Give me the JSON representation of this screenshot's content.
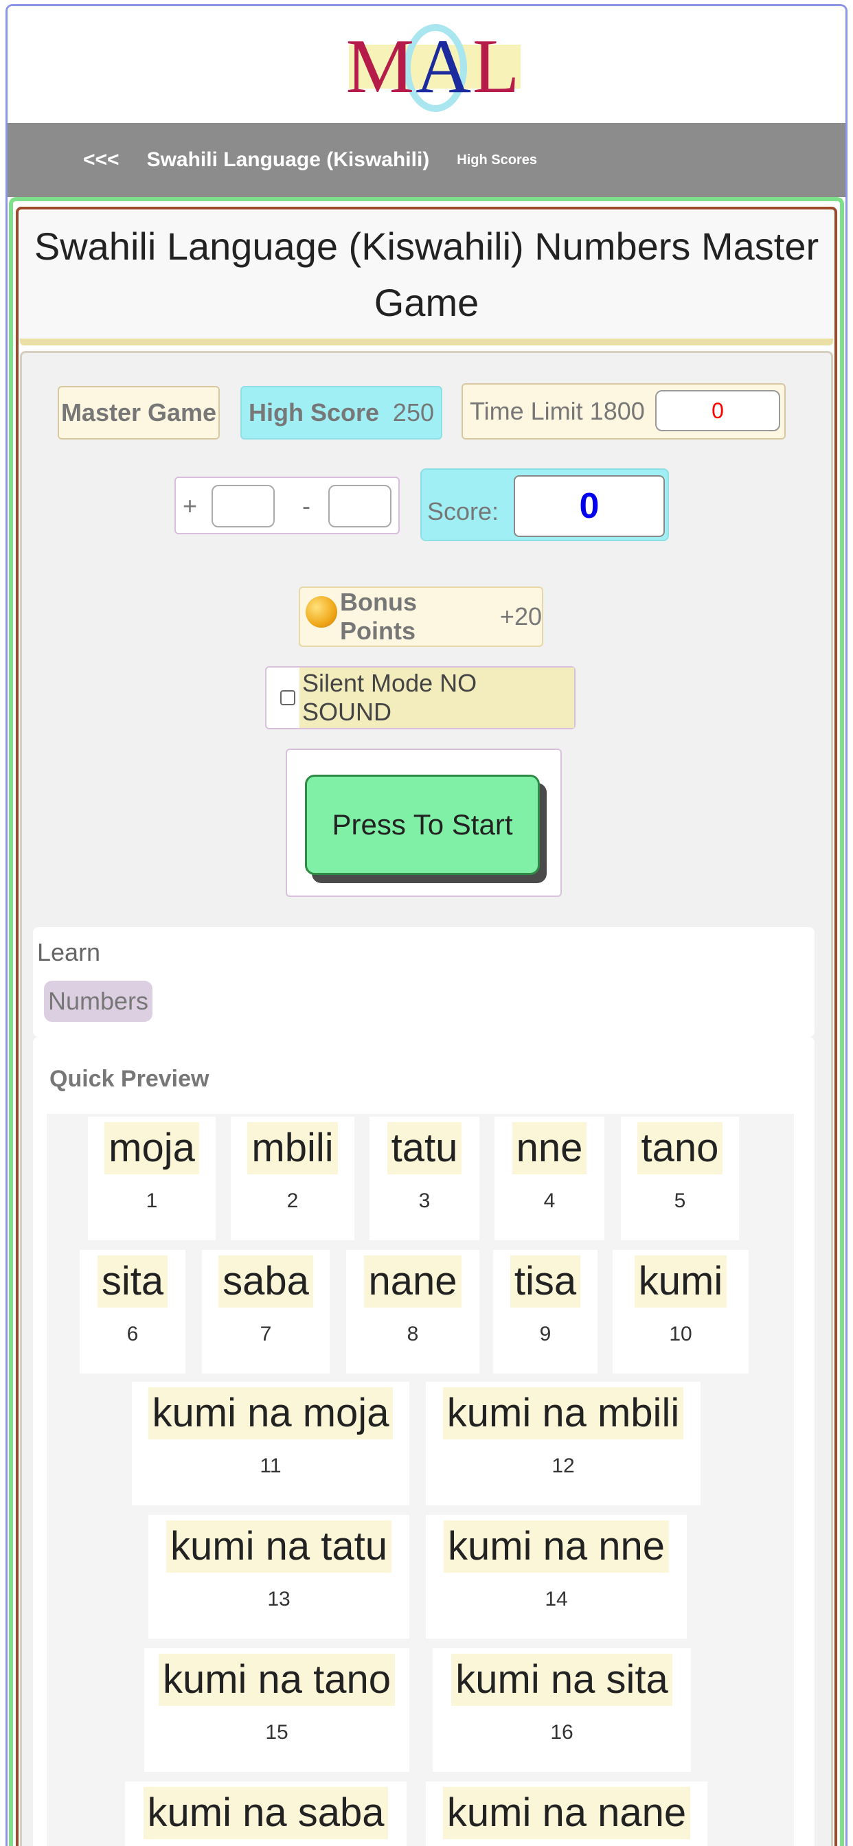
{
  "logo": {
    "letters": [
      "M",
      "A",
      "L"
    ]
  },
  "nav": {
    "back_label": "<<<",
    "crumb_label": "Swahili Language (Kiswahili)",
    "high_scores_label": "High Scores"
  },
  "page": {
    "title": "Swahili Language (Kiswahili) Numbers Master Game"
  },
  "game": {
    "mode_label": "Master Game",
    "high_score_label": "High Score",
    "high_score_value": "250",
    "time_limit_label": "Time Limit 1800",
    "time_value": "0",
    "plus_symbol": "+",
    "minus_symbol": "-",
    "score_label": "Score:",
    "score_value": "0",
    "bonus_label": "Bonus Points",
    "bonus_value": "+20",
    "silent_label": "Silent Mode NO SOUND",
    "start_label": "Press To Start"
  },
  "learn": {
    "label": "Learn",
    "tag": "Numbers"
  },
  "preview": {
    "label": "Quick Preview",
    "cards": [
      {
        "word": "moja",
        "num": "1"
      },
      {
        "word": "mbili",
        "num": "2"
      },
      {
        "word": "tatu",
        "num": "3"
      },
      {
        "word": "nne",
        "num": "4"
      },
      {
        "word": "tano",
        "num": "5"
      },
      {
        "word": "sita",
        "num": "6"
      },
      {
        "word": "saba",
        "num": "7"
      },
      {
        "word": "nane",
        "num": "8"
      },
      {
        "word": "tisa",
        "num": "9"
      },
      {
        "word": "kumi",
        "num": "10"
      },
      {
        "word": "kumi na moja",
        "num": "11"
      },
      {
        "word": "kumi na mbili",
        "num": "12"
      },
      {
        "word": "kumi na tatu",
        "num": "13"
      },
      {
        "word": "kumi na nne",
        "num": "14"
      },
      {
        "word": "kumi na tano",
        "num": "15"
      },
      {
        "word": "kumi na sita",
        "num": "16"
      },
      {
        "word": "kumi na saba",
        "num": ""
      },
      {
        "word": "kumi na nane",
        "num": ""
      }
    ]
  },
  "colors": {
    "frame_border": "#8b95e6",
    "navbar_bg": "#8c8c8c",
    "green_border": "#7ee08b",
    "start_button": "#7ff0a6",
    "score_panel": "#9feff5",
    "time_value_color": "#ff0000",
    "score_value_color": "#0000ee"
  }
}
